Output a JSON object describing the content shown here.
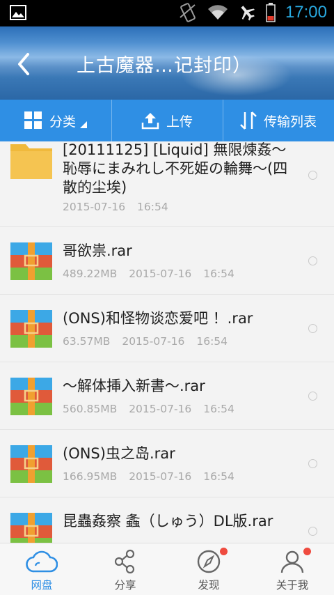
{
  "status_bar": {
    "time": "17:00",
    "icons": [
      "gallery-icon",
      "vibrate-icon",
      "wifi-icon",
      "airplane-icon",
      "battery-icon"
    ]
  },
  "header": {
    "title": "上古魔器…记封印）"
  },
  "toolbar": {
    "classify_label": "分类",
    "upload_label": "上传",
    "transfer_label": "传输列表"
  },
  "files": [
    {
      "type": "folder",
      "name": "[20111125] [Liquid] 無限煉姦～恥辱にまみれし不死姫の輪舞～(四散的尘埃)",
      "size": "",
      "date": "2015-07-16",
      "time": "16:54"
    },
    {
      "type": "rar",
      "name": "哥欲祟.rar",
      "size": "489.22MB",
      "date": "2015-07-16",
      "time": "16:54"
    },
    {
      "type": "rar",
      "name": "(ONS)和怪物谈恋爱吧 ！.rar",
      "size": "63.57MB",
      "date": "2015-07-16",
      "time": "16:54"
    },
    {
      "type": "rar",
      "name": "～解体挿入新書～.rar",
      "size": "560.85MB",
      "date": "2015-07-16",
      "time": "16:54"
    },
    {
      "type": "rar",
      "name": "(ONS)虫之岛.rar",
      "size": "166.95MB",
      "date": "2015-07-16",
      "time": "16:54"
    },
    {
      "type": "rar",
      "name": "昆蟲姦察 螽（しゅう）DL版.rar",
      "size": "",
      "date": "",
      "time": ""
    }
  ],
  "bottom_nav": {
    "items": [
      {
        "label": "网盘",
        "active": true
      },
      {
        "label": "分享",
        "active": false
      },
      {
        "label": "发现",
        "active": false,
        "badge": true
      },
      {
        "label": "关于我",
        "active": false,
        "badge": true
      }
    ]
  },
  "colors": {
    "accent": "#2f8fe4",
    "badge": "#ef4b3f",
    "folder": "#f5c24c"
  }
}
